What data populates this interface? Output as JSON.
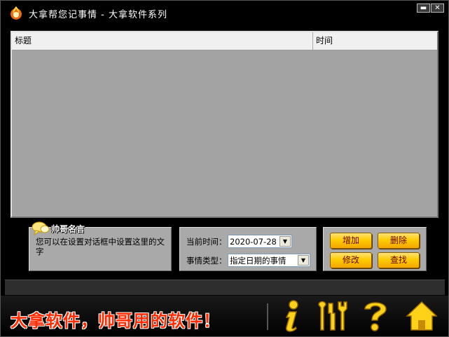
{
  "window": {
    "title": "大拿帮您记事情 - 大拿软件系列",
    "minimize_glyph": "▬",
    "close_glyph": "✕"
  },
  "list": {
    "columns": [
      "标题",
      "时间"
    ],
    "rows": []
  },
  "quote": {
    "title": "帅哥名言",
    "text": "您可以在设置对话框中设置这里的文字"
  },
  "filters": {
    "date_label": "当前时间：",
    "date_value": "2020-07-28",
    "type_label": "事情类型：",
    "type_value": "指定日期的事情"
  },
  "actions": {
    "add": "增加",
    "delete": "删除",
    "edit": "修改",
    "find": "查找"
  },
  "banner": {
    "slogan": "大拿软件，帅哥用的软件！",
    "icons": [
      "info-icon",
      "tools-icon",
      "help-icon",
      "home-icon"
    ]
  },
  "colors": {
    "accent_yellow": "#ffcc00",
    "slogan_red": "#ff2a00",
    "panel_gray": "#a9a9a9",
    "list_bg": "#a3a3a3"
  }
}
